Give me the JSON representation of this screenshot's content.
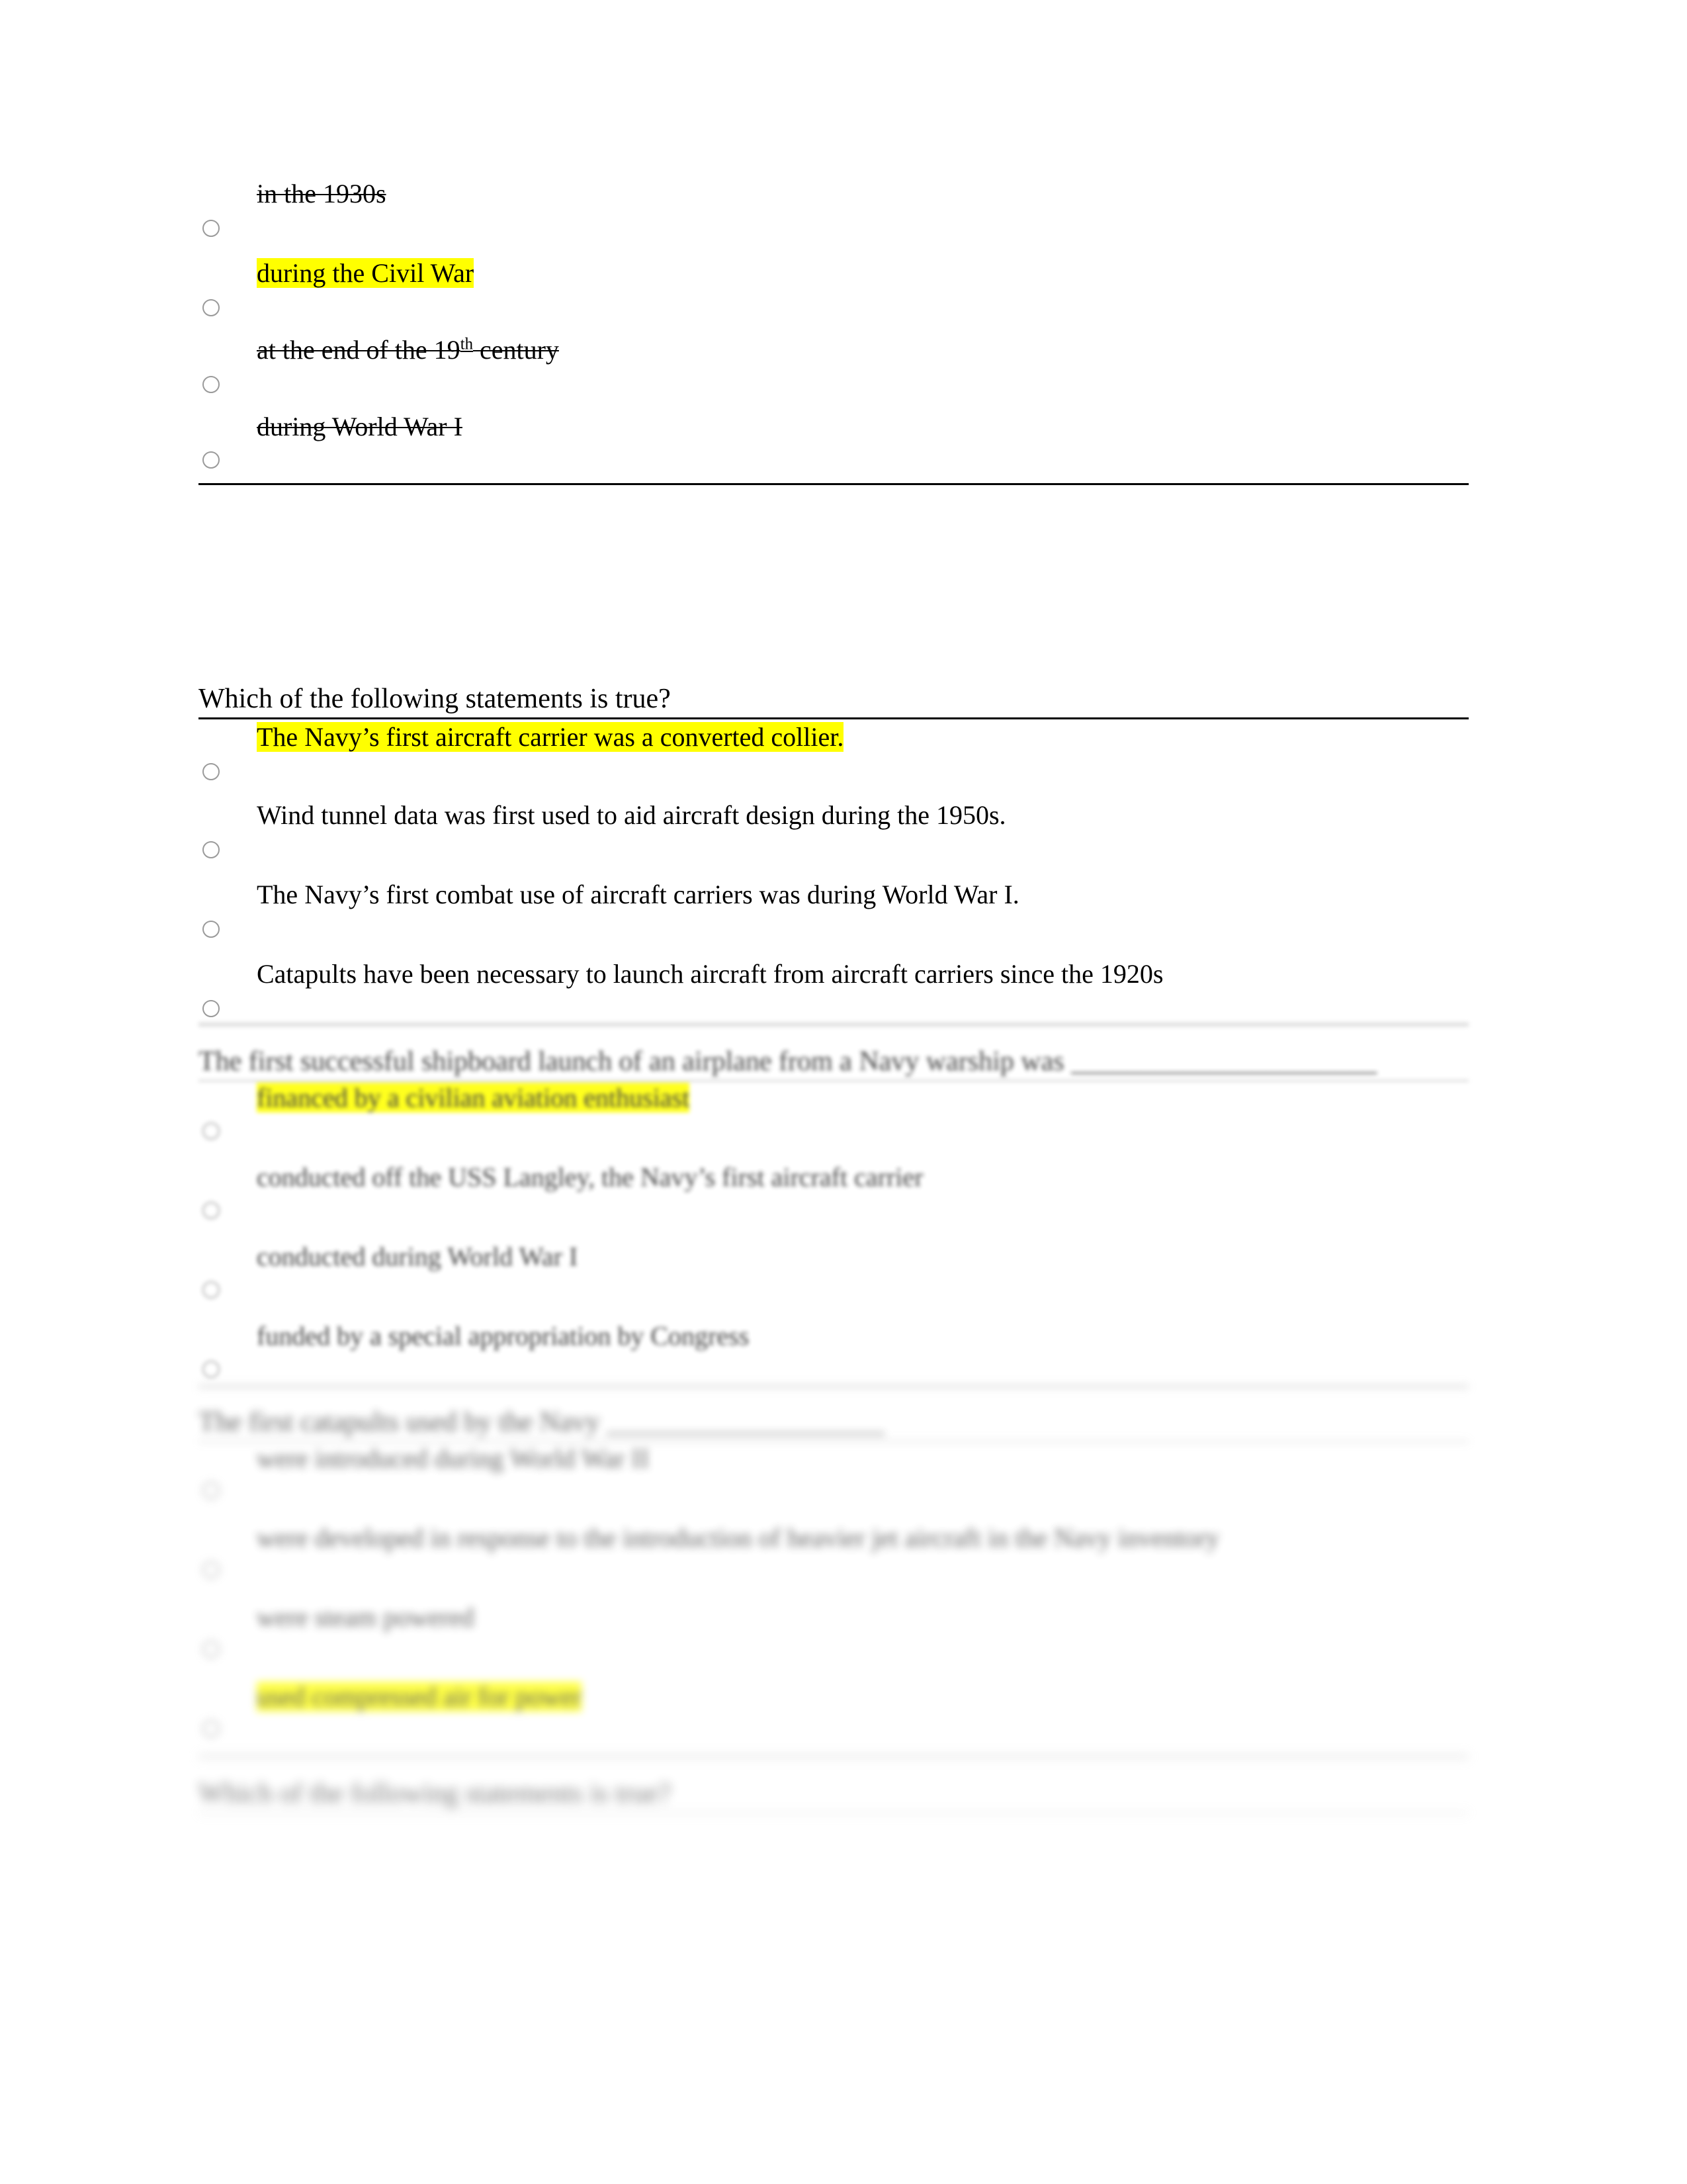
{
  "document": {
    "type": "quiz-answer-review",
    "highlight_color": "#ffff00",
    "page_background": "#ffffff",
    "text_color": "#000000"
  },
  "questions": [
    {
      "id": "q-partial-top",
      "stem": "",
      "stem_visible": false,
      "options": [
        {
          "label": "in the 1930s",
          "highlighted": false,
          "struck": true,
          "selected": false
        },
        {
          "label": "during the Civil War",
          "highlighted": true,
          "struck": false,
          "selected": false
        },
        {
          "label": "at the end of the 19th century",
          "label_pre": "at the end of the 19",
          "label_sup": "th",
          "label_post": " century",
          "highlighted": false,
          "struck": true,
          "selected": false
        },
        {
          "label": "during World War I",
          "highlighted": false,
          "struck": true,
          "selected": false
        }
      ]
    },
    {
      "id": "q-statements-true",
      "stem": "Which of the following statements is true?",
      "stem_visible": true,
      "options": [
        {
          "label": "The Navy’s first aircraft carrier was a converted collier.",
          "highlighted": true,
          "struck": false,
          "selected": false
        },
        {
          "label": "Wind tunnel data was first used to aid aircraft design during the 1950s.",
          "highlighted": false,
          "struck": false,
          "selected": false
        },
        {
          "label": "The Navy’s first combat use of aircraft carriers was during World War I.",
          "highlighted": false,
          "struck": false,
          "selected": false
        },
        {
          "label": "Catapults have been necessary to launch aircraft from aircraft carriers since the 1920s",
          "highlighted": false,
          "struck": false,
          "selected": false
        }
      ]
    },
    {
      "id": "q-shipboard-launch",
      "stem": "The first successful shipboard launch of an airplane from a Navy warship was ______________________",
      "stem_visible": true,
      "blurred": true,
      "options": [
        {
          "label": "financed by a civilian aviation enthusiast",
          "highlighted": true,
          "struck": false,
          "selected": false
        },
        {
          "label": "conducted off the USS Langley, the Navy’s first aircraft carrier",
          "highlighted": false,
          "struck": false,
          "selected": false
        },
        {
          "label": "conducted during World War I",
          "highlighted": false,
          "struck": false,
          "selected": false
        },
        {
          "label": "funded by a special appropriation by Congress",
          "highlighted": false,
          "struck": false,
          "selected": false
        }
      ]
    },
    {
      "id": "q-first-catapults",
      "stem": "The first catapults used by the Navy ____________________",
      "stem_visible": true,
      "blurred": true,
      "options": [
        {
          "label": "were introduced during World War II",
          "highlighted": false,
          "struck": false,
          "selected": false
        },
        {
          "label": "were developed in response to the introduction of heavier jet aircraft in the Navy inventory",
          "highlighted": false,
          "struck": false,
          "selected": false
        },
        {
          "label": "were steam powered",
          "highlighted": false,
          "struck": false,
          "selected": false
        },
        {
          "label": "used compressed air for power",
          "highlighted": true,
          "struck": false,
          "selected": false
        }
      ]
    },
    {
      "id": "q-statements-true-2",
      "stem": "Which of the following statements is true?",
      "stem_visible": true,
      "blurred": true,
      "options": []
    }
  ]
}
